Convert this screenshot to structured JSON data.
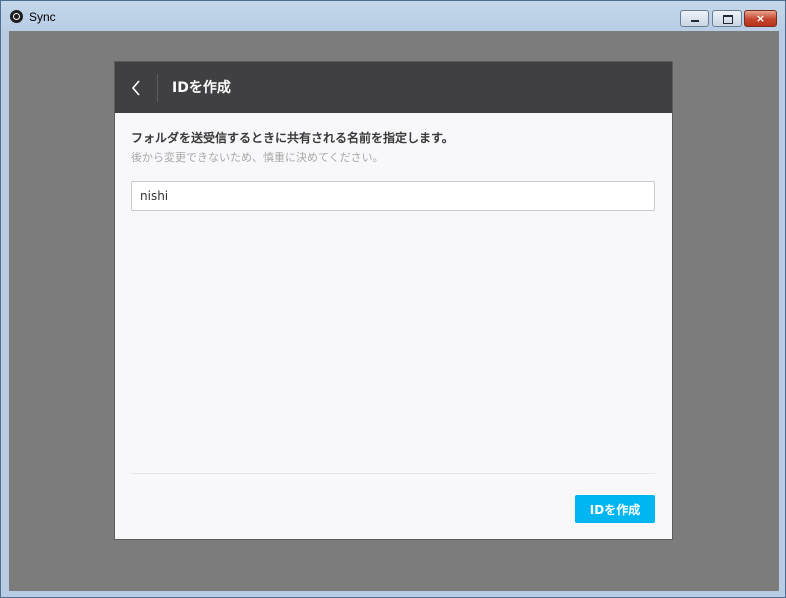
{
  "window": {
    "title": "Sync",
    "icon": "sync-app-icon",
    "controls": {
      "minimize": "minimize-icon",
      "maximize": "maximize-icon",
      "close": "×"
    }
  },
  "dialog": {
    "back_icon": "chevron-left-icon",
    "title": "IDを作成",
    "description": "フォルダを送受信するときに共有される名前を指定します。",
    "note": "後から変更できないため、慎重に決めてください。",
    "id_input": {
      "value": "nishi"
    },
    "create_button": "IDを作成"
  },
  "colors": {
    "header_bg": "#404042",
    "accent": "#00b6f0",
    "overlay": "#7c7c7c"
  }
}
